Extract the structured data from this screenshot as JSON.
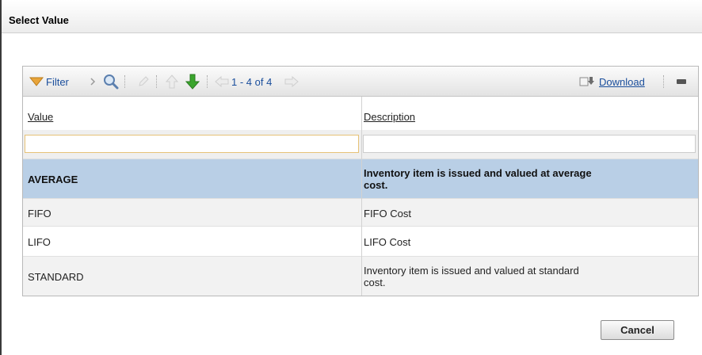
{
  "dialog": {
    "title": "Select Value"
  },
  "toolbar": {
    "filter_label": "Filter",
    "pager_label": "1 - 4 of 4",
    "download_label": "Download"
  },
  "columns": [
    "Value",
    "Description"
  ],
  "filters": {
    "value": "",
    "description": ""
  },
  "rows": [
    {
      "value": "AVERAGE",
      "description": "Inventory item is issued and valued at average cost.",
      "selected": true
    },
    {
      "value": "FIFO",
      "description": "FIFO Cost"
    },
    {
      "value": "LIFO",
      "description": "LIFO Cost"
    },
    {
      "value": "STANDARD",
      "description": "Inventory item is issued and valued at standard cost."
    }
  ],
  "buttons": {
    "cancel": "Cancel"
  },
  "colors": {
    "selected_row": "#b9cfe6",
    "link": "#1a4e9c",
    "filter_icon": "#e8a43a",
    "down_arrow": "#3aa52d"
  }
}
